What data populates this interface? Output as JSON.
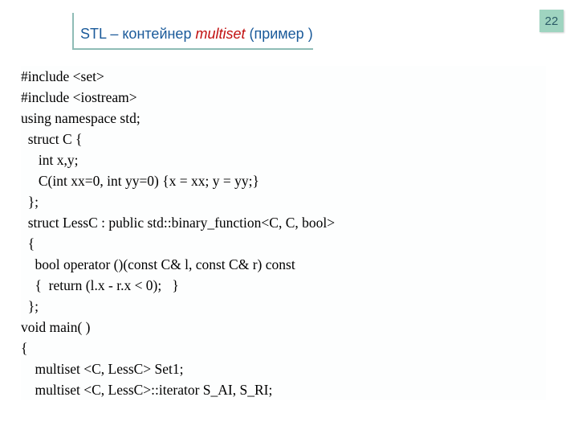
{
  "page_number": "22",
  "title": {
    "blue_prefix": "STL – контейнер ",
    "red_italic": "multiset",
    "blue_suffix": "  (пример )"
  },
  "code_lines": [
    "#include <set>",
    "#include <iostream>",
    "using namespace std;",
    "  struct C {",
    "     int x,y;",
    "     C(int xx=0, int yy=0) {x = xx; y = yy;}",
    "  };",
    "  struct LessC : public std::binary_function<C, C, bool>",
    "  {",
    "    bool operator ()(const C& l, const C& r) const",
    "    {  return (l.x - r.x < 0);   }",
    "  };",
    "",
    "void main( )",
    "{",
    "    multiset <C, LessC> Set1;",
    "    multiset <C, LessC>::iterator S_AI, S_RI;"
  ]
}
